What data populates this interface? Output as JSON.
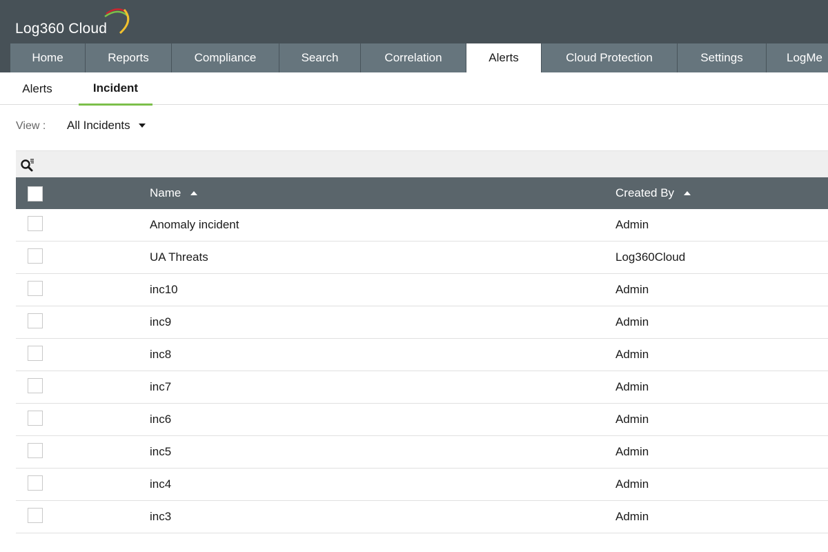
{
  "app": {
    "logo_text": "Log360 Cloud"
  },
  "nav": {
    "tabs": [
      {
        "label": "Home"
      },
      {
        "label": "Reports"
      },
      {
        "label": "Compliance"
      },
      {
        "label": "Search"
      },
      {
        "label": "Correlation"
      },
      {
        "label": "Alerts",
        "active": true
      },
      {
        "label": "Cloud Protection"
      },
      {
        "label": "Settings"
      },
      {
        "label": "LogMe"
      }
    ]
  },
  "subtabs": {
    "alerts": "Alerts",
    "incident": "Incident",
    "active": "Incident"
  },
  "view": {
    "label": "View :",
    "selected": "All Incidents"
  },
  "table": {
    "search_icon": "search-filter-icon",
    "columns": {
      "name": "Name",
      "created_by": "Created By"
    },
    "rows": [
      {
        "name": "Anomaly incident",
        "created_by": "Admin"
      },
      {
        "name": "UA Threats",
        "created_by": "Log360Cloud"
      },
      {
        "name": "inc10",
        "created_by": "Admin"
      },
      {
        "name": "inc9",
        "created_by": "Admin"
      },
      {
        "name": "inc8",
        "created_by": "Admin"
      },
      {
        "name": "inc7",
        "created_by": "Admin"
      },
      {
        "name": "inc6",
        "created_by": "Admin"
      },
      {
        "name": "inc5",
        "created_by": "Admin"
      },
      {
        "name": "inc4",
        "created_by": "Admin"
      },
      {
        "name": "inc3",
        "created_by": "Admin"
      }
    ]
  },
  "colors": {
    "header_bg": "#475157",
    "nav_tab_bg": "#66757d",
    "table_header_bg": "#5a656b",
    "active_subtab_underline": "#7cbf4a"
  }
}
